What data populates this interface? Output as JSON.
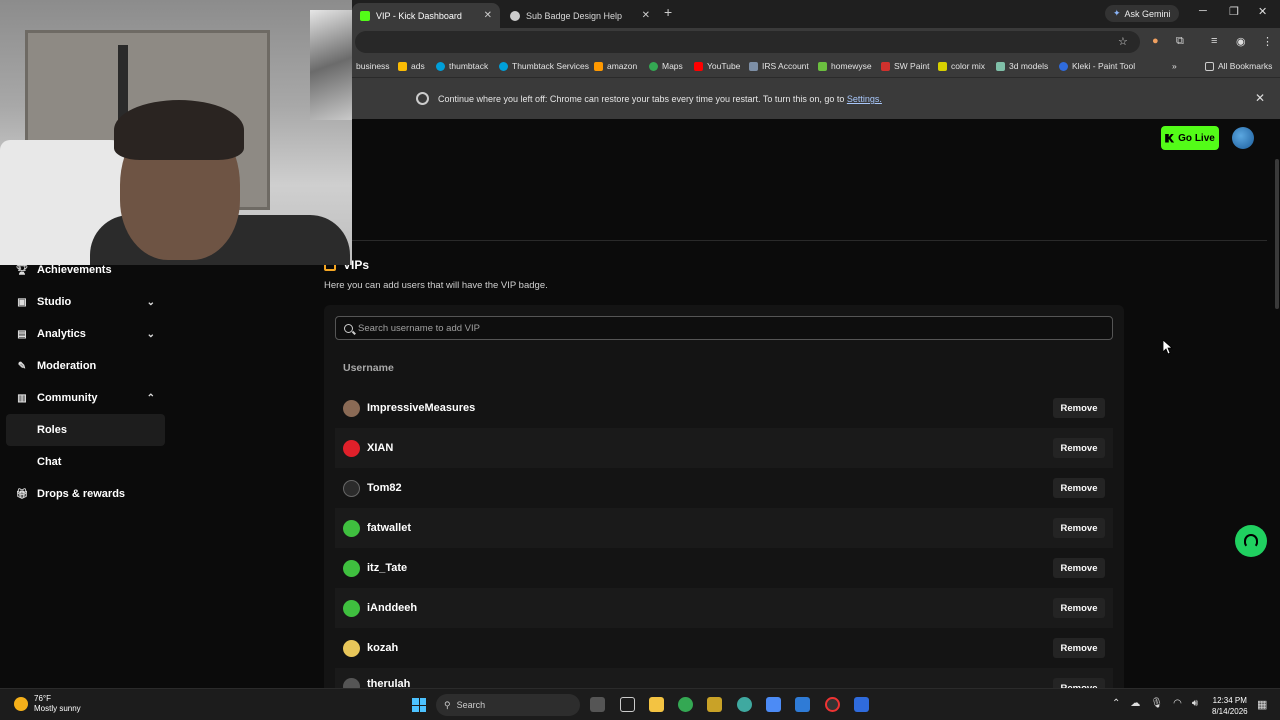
{
  "browser": {
    "tabs": [
      {
        "title": "VIP - Kick Dashboard",
        "active": true
      },
      {
        "title": "Sub Badge Design Help",
        "active": false
      }
    ],
    "new_tab_glyph": "+",
    "ask_gemini": "Ask Gemini",
    "bookmarks": [
      {
        "label": "business",
        "icon": "folder-icon"
      },
      {
        "label": "ads",
        "icon": "google-ads-icon"
      },
      {
        "label": "thumbtack",
        "icon": "thumbtack-icon"
      },
      {
        "label": "Thumbtack Services",
        "icon": "thumbtack-icon"
      },
      {
        "label": "amazon",
        "icon": "amazon-icon"
      },
      {
        "label": "Maps",
        "icon": "maps-icon"
      },
      {
        "label": "YouTube",
        "icon": "youtube-icon"
      },
      {
        "label": "IRS Account",
        "icon": "irs-icon"
      },
      {
        "label": "homewyse",
        "icon": "homewyse-icon"
      },
      {
        "label": "SW Paint",
        "icon": "paint-icon"
      },
      {
        "label": "color mix",
        "icon": "colormix-icon"
      },
      {
        "label": "3d models",
        "icon": "3d-icon"
      },
      {
        "label": "Kleki - Paint Tool",
        "icon": "kleki-icon"
      }
    ],
    "all_bookmarks": "All Bookmarks",
    "infobar": {
      "text": "Continue where you left off: Chrome can restore your tabs every time you restart. To turn this on, go to",
      "link": "Settings."
    }
  },
  "header": {
    "go_live": "Go Live"
  },
  "sidebar": {
    "items": [
      {
        "label": "Achievements",
        "icon": "trophy-icon",
        "chevron": ""
      },
      {
        "label": "Studio",
        "icon": "studio-icon",
        "chevron": "⌄"
      },
      {
        "label": "Analytics",
        "icon": "analytics-icon",
        "chevron": "⌄"
      },
      {
        "label": "Moderation",
        "icon": "wrench-icon",
        "chevron": ""
      },
      {
        "label": "Community",
        "icon": "community-icon",
        "chevron": "⌃"
      },
      {
        "label": "Roles",
        "sub": true,
        "active": true
      },
      {
        "label": "Chat",
        "sub": true
      },
      {
        "label": "Drops & rewards",
        "icon": "gift-icon",
        "chevron": ""
      }
    ]
  },
  "vip": {
    "title": "VIPs",
    "description": "Here you can add users that will have the VIP badge.",
    "search_placeholder": "Search username to add VIP",
    "column_header": "Username",
    "remove_label": "Remove",
    "users": [
      {
        "name": "ImpressiveMeasures",
        "avatar_color": "#8a6a55"
      },
      {
        "name": "XIAN",
        "avatar_color": "#e0202a"
      },
      {
        "name": "Tom82",
        "avatar_color": "#2b2b2b"
      },
      {
        "name": "fatwallet",
        "avatar_color": "#3fbf3f"
      },
      {
        "name": "itz_Tate",
        "avatar_color": "#3fbf3f"
      },
      {
        "name": "iAnddeeh",
        "avatar_color": "#3fbf3f"
      },
      {
        "name": "kozah",
        "avatar_color": "#e8c65a"
      },
      {
        "name": "therulah",
        "avatar_color": "#555555"
      }
    ]
  },
  "taskbar": {
    "weather_temp": "76°F",
    "weather_desc": "Mostly sunny",
    "search_label": "Search",
    "time": "12:34 PM",
    "date": "8/14/2026"
  },
  "colors": {
    "accent_green": "#53fc18",
    "background": "#0b0b0b"
  }
}
